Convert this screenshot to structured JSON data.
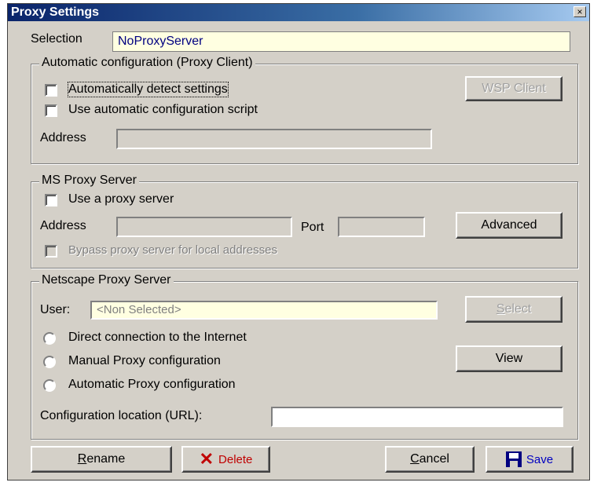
{
  "window": {
    "title": "Proxy Settings",
    "close_label": "×"
  },
  "selection": {
    "label": "Selection",
    "value": "NoProxyServer"
  },
  "auto_config": {
    "legend": "Automatic configuration (Proxy Client)",
    "detect_label": "Automatically detect settings",
    "script_label": "Use automatic configuration script",
    "address_label": "Address",
    "address_value": "",
    "wsp_button": "WSP Client"
  },
  "ms_proxy": {
    "legend": "MS Proxy Server",
    "use_proxy_label": "Use a proxy server",
    "address_label": "Address",
    "address_value": "",
    "port_label": "Port",
    "port_value": "",
    "advanced_button": "Advanced",
    "bypass_label": "Bypass proxy server for local addresses"
  },
  "netscape_proxy": {
    "legend": "Netscape Proxy Server",
    "user_label": "User:",
    "user_value": "<Non Selected>",
    "select_button_first": "S",
    "select_button_rest": "elect",
    "radio_direct": "Direct connection to the Internet",
    "radio_manual": "Manual Proxy configuration",
    "radio_auto": "Automatic Proxy configuration",
    "view_button": "View",
    "config_url_label": "Configuration location (URL):",
    "config_url_value": ""
  },
  "footer": {
    "rename_first": "R",
    "rename_rest": "ename",
    "delete_label": "Delete",
    "cancel_first": "C",
    "cancel_rest": "ancel",
    "save_label": "Save"
  },
  "colors": {
    "delete": "#c00000",
    "save": "#0000c0",
    "selection_text": "#000080"
  }
}
